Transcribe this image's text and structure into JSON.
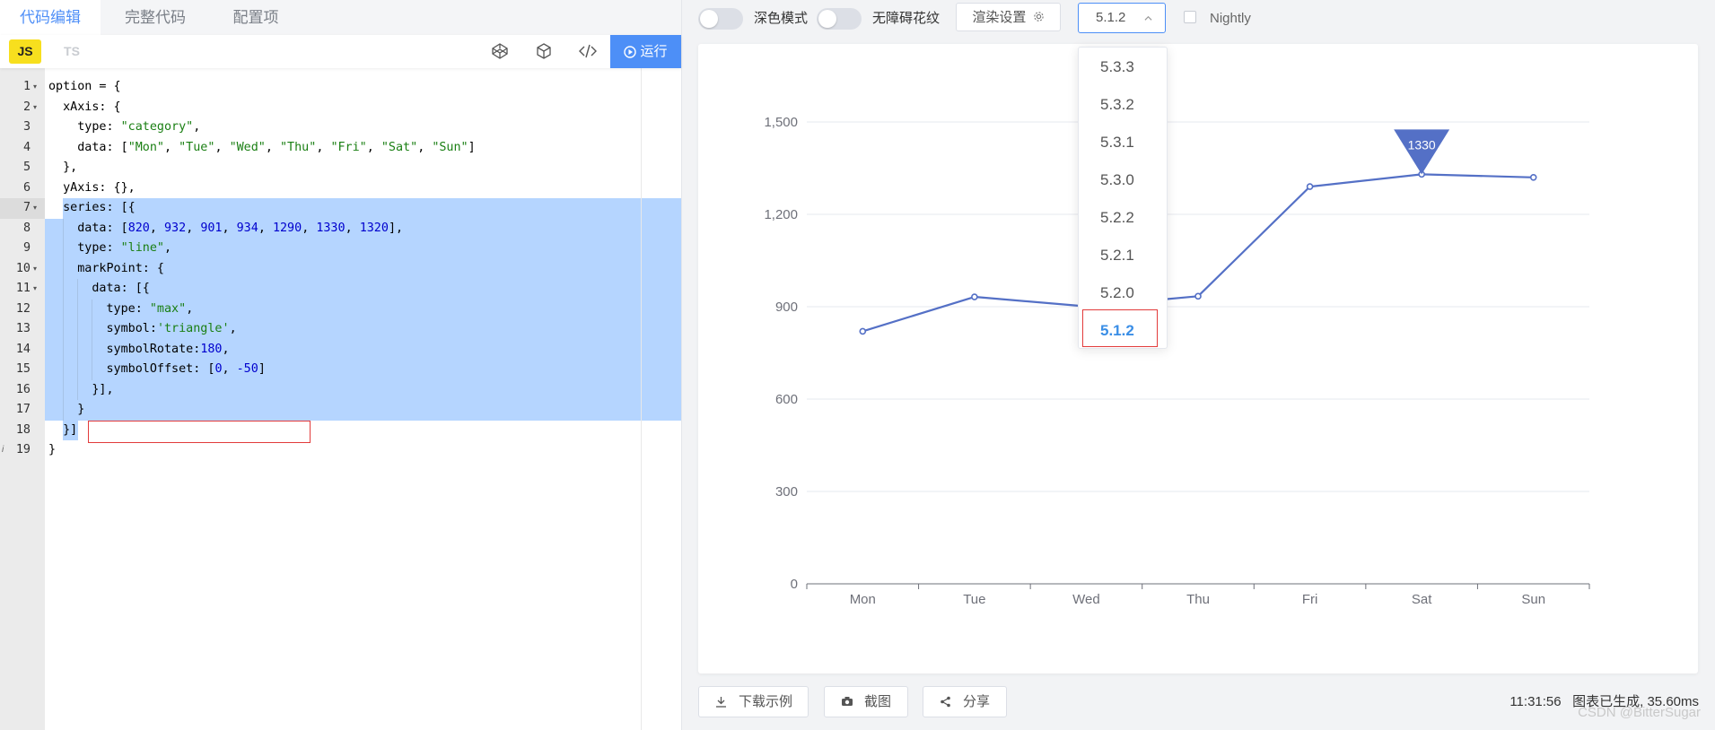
{
  "editor_tabs": [
    {
      "label": "代码编辑"
    },
    {
      "label": "完整代码"
    },
    {
      "label": "配置项"
    }
  ],
  "lang_tabs": {
    "js": "JS",
    "ts": "TS"
  },
  "toolbar": {
    "run_label": "运行"
  },
  "code_lines": [
    "option = {",
    "  xAxis: {",
    "    type: \"category\",",
    "    data: [\"Mon\", \"Tue\", \"Wed\", \"Thu\", \"Fri\", \"Sat\", \"Sun\"]",
    "  },",
    "  yAxis: {},",
    "  series: [{",
    "    data: [820, 932, 901, 934, 1290, 1330, 1320],",
    "    type: \"line\",",
    "    markPoint: {",
    "      data: [{",
    "        type: \"max\",",
    "        symbol:'triangle',",
    "        symbolRotate:180,",
    "        symbolOffset: [0, -50]",
    "      }],",
    "    }",
    "  }]",
    "}"
  ],
  "line_numbers": [
    "1",
    "2",
    "3",
    "4",
    "5",
    "6",
    "7",
    "8",
    "9",
    "10",
    "11",
    "12",
    "13",
    "14",
    "15",
    "16",
    "17",
    "18",
    "19"
  ],
  "topbar": {
    "dark_mode_label": "深色模式",
    "a11y_label": "无障碍花纹",
    "render_settings_label": "渲染设置",
    "version_value": "5.1.2",
    "nightly_label": "Nightly"
  },
  "version_options": [
    "5.3.3",
    "5.3.2",
    "5.3.1",
    "5.3.0",
    "5.2.2",
    "5.2.1",
    "5.2.0",
    "5.1.2"
  ],
  "selected_version": "5.1.2",
  "bottom": {
    "download_label": "下载示例",
    "screenshot_label": "截图",
    "share_label": "分享",
    "gen_time": "11:31:56",
    "gen_info": "图表已生成, 35.60ms",
    "watermark": "CSDN @BitterSugar"
  },
  "colors": {
    "series": "#5470c6",
    "accent": "#4d8ff7",
    "highlight": "#e23b3b"
  },
  "chart_data": {
    "type": "line",
    "categories": [
      "Mon",
      "Tue",
      "Wed",
      "Thu",
      "Fri",
      "Sat",
      "Sun"
    ],
    "values": [
      820,
      932,
      901,
      934,
      1290,
      1330,
      1320
    ],
    "ylim": [
      0,
      1500
    ],
    "yticks": [
      "0",
      "300",
      "600",
      "900",
      "1,200",
      "1,500"
    ],
    "markpoint": {
      "category": "Sat",
      "value": 1330,
      "label": "1330",
      "symbol": "triangle",
      "rotate": 180,
      "offset_y": -50
    },
    "grid": true
  }
}
